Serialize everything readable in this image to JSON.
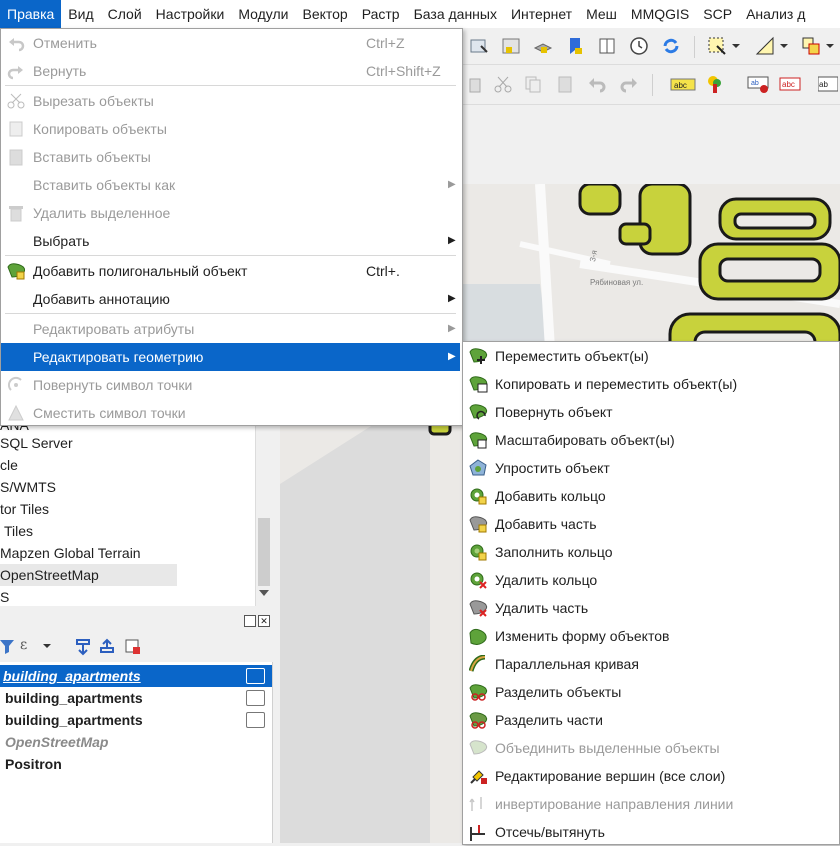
{
  "menubar": [
    "Правка",
    "Вид",
    "Слой",
    "Настройки",
    "Модули",
    "Вектор",
    "Растр",
    "База данных",
    "Интернет",
    "Меш",
    "MMQGIS",
    "SCP",
    "Анализ д"
  ],
  "edit_menu": {
    "undo": {
      "label": "Отменить",
      "shortcut": "Ctrl+Z"
    },
    "redo": {
      "label": "Вернуть",
      "shortcut": "Ctrl+Shift+Z"
    },
    "cut": {
      "label": "Вырезать объекты"
    },
    "copy": {
      "label": "Копировать объекты"
    },
    "paste": {
      "label": "Вставить объекты"
    },
    "paste_as": {
      "label": "Вставить объекты как"
    },
    "delete": {
      "label": "Удалить выделенное"
    },
    "select": {
      "label": "Выбрать"
    },
    "add_polygon": {
      "label": "Добавить полигональный объект",
      "shortcut": "Ctrl+."
    },
    "add_annotation": {
      "label": "Добавить аннотацию"
    },
    "edit_attributes": {
      "label": "Редактировать атрибуты"
    },
    "edit_geometry": {
      "label": "Редактировать геометрию"
    },
    "rotate_symbol": {
      "label": "Повернуть символ точки"
    },
    "offset_symbol": {
      "label": "Сместить символ точки"
    }
  },
  "geometry_submenu": [
    "Переместить объект(ы)",
    "Копировать и переместить объект(ы)",
    "Повернуть объект",
    "Масштабировать объект(ы)",
    "Упростить объект",
    "Добавить кольцо",
    "Добавить часть",
    "Заполнить кольцо",
    "Удалить кольцо",
    "Удалить часть",
    "Изменить форму объектов",
    "Параллельная кривая",
    "Разделить объекты",
    "Разделить части",
    "Объединить выделенные объекты",
    "Редактирование вершин (все слои)",
    "инвертирование направления линии",
    "Отсечь/вытянуть"
  ],
  "browser_items": [
    "ANA",
    "SQL Server",
    "cle",
    "S/WMTS",
    "tor Tiles",
    "Tiles",
    "Mapzen Global Terrain",
    "OpenStreetMap",
    "S"
  ],
  "layers": [
    {
      "name": "building_apartments"
    },
    {
      "name": "building_apartments"
    },
    {
      "name": "building_apartments"
    },
    {
      "name": "OpenStreetMap"
    },
    {
      "name": "Positron"
    }
  ],
  "map_labels": {
    "street1": "Рябиновая ул.",
    "street2": "3-я"
  },
  "toolbar_labels": {
    "abc": "abc"
  },
  "colors": {
    "accent": "#0a66c9",
    "building_fill": "#c8d23c",
    "building_stroke": "#1a1a1a"
  }
}
